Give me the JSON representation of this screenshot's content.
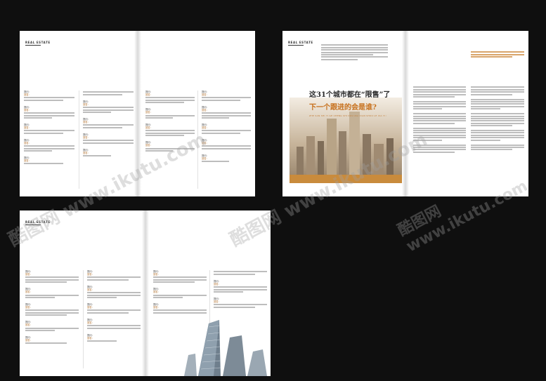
{
  "brand": "REAL ESTATE",
  "feature": {
    "title_line1": "这31个城市都在“限售”了",
    "title_line2": "下一个跟进的会是谁?",
    "title_en": "ZHE SAN SHI YI GE CHENG SHI DOU ZAI XIAN SHOU LE XIA YI GE GEN JIN DE HUI SHI SHEI"
  },
  "qa_labels": {
    "q": "提问：",
    "a": "回答："
  },
  "watermark": "酷图网 www.ikutu.com",
  "colors": {
    "accent": "#c98b3c",
    "background": "#0f0f0f"
  }
}
